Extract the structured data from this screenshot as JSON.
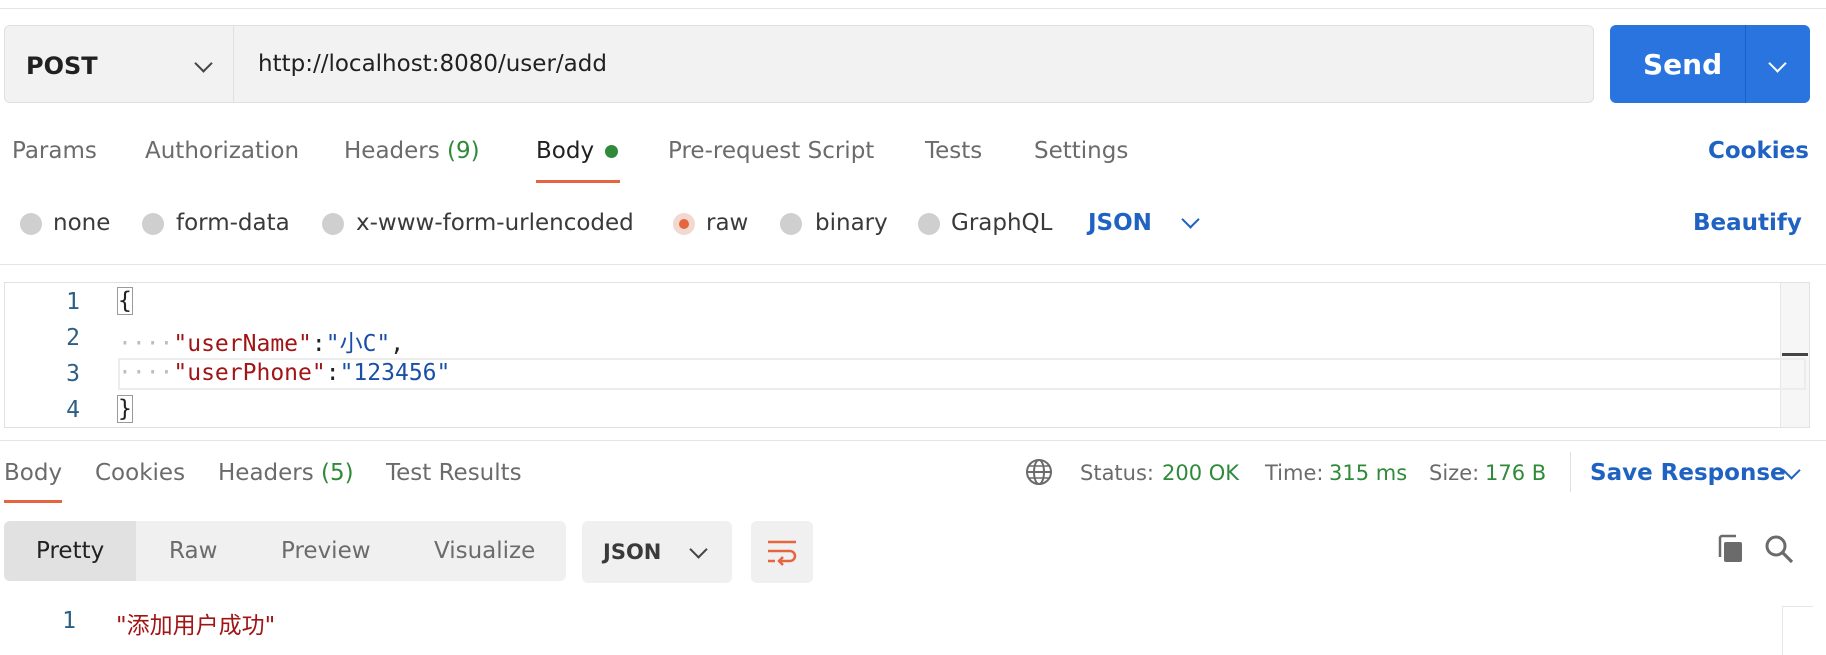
{
  "request": {
    "method": "POST",
    "url": "http://localhost:8080/user/add",
    "send_label": "Send"
  },
  "request_tabs": {
    "params": "Params",
    "authorization": "Authorization",
    "headers": "Headers",
    "headers_count": "(9)",
    "body": "Body",
    "prerequest": "Pre-request Script",
    "tests": "Tests",
    "settings": "Settings",
    "cookies": "Cookies"
  },
  "body_types": {
    "none": "none",
    "form_data": "form-data",
    "urlencoded": "x-www-form-urlencoded",
    "raw": "raw",
    "binary": "binary",
    "graphql": "GraphQL",
    "selected_format": "JSON",
    "beautify": "Beautify"
  },
  "editor": {
    "line_numbers": [
      "1",
      "2",
      "3",
      "4"
    ],
    "open_brace": "{",
    "close_brace": "}",
    "indent": "····",
    "line2_key": "\"userName\"",
    "line2_sep": ":",
    "line2_value": "\"小C\"",
    "line2_comma": ",",
    "line3_key": "\"userPhone\"",
    "line3_sep": ":",
    "line3_value": "\"123456\""
  },
  "response_tabs": {
    "body": "Body",
    "cookies": "Cookies",
    "headers": "Headers",
    "headers_count": "(5)",
    "test_results": "Test Results"
  },
  "response_meta": {
    "status_label": "Status:",
    "status_value": "200 OK",
    "time_label": "Time:",
    "time_value": "315 ms",
    "size_label": "Size:",
    "size_value": "176 B",
    "save_response": "Save Response"
  },
  "view_modes": {
    "pretty": "Pretty",
    "raw": "Raw",
    "preview": "Preview",
    "visualize": "Visualize",
    "format": "JSON"
  },
  "response_body": {
    "line_number": "1",
    "content": "\"添加用户成功\""
  },
  "colors": {
    "accent_blue": "#2a74e0",
    "active_orange": "#e5653e",
    "success_green": "#2f8a3a"
  }
}
